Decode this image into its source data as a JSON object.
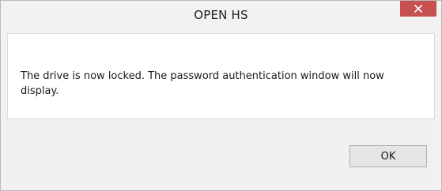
{
  "window": {
    "title": "OPEN HS",
    "close_icon": "close-icon"
  },
  "dialog": {
    "message": "The drive is now locked. The password authentication window will now display.",
    "ok_label": "OK"
  },
  "colors": {
    "close_button_bg": "#c75050",
    "window_bg": "#f2f2f2",
    "content_bg": "#ffffff"
  }
}
